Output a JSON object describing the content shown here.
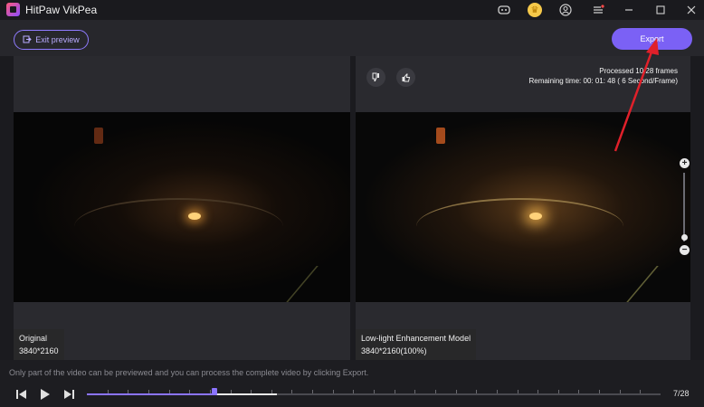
{
  "app": {
    "title": "HitPaw VikPea"
  },
  "titlebar_icons": [
    "discord-icon",
    "coin-icon",
    "user-icon",
    "menu-icon",
    "minimize-icon",
    "maximize-icon",
    "close-icon"
  ],
  "toolbar": {
    "exit_label": "Exit preview",
    "export_label": "Export"
  },
  "left_panel": {
    "name": "Original",
    "resolution": "3840*2160"
  },
  "right_panel": {
    "name": "Low-light Enhancement Model",
    "resolution": "3840*2160(100%)",
    "processed": "Processed 10/28 frames",
    "remaining": "Remaining time: 00: 01: 48 ( 6 Second/Frame)"
  },
  "footer": {
    "notice": "Only part of the video can be previewed and you can process the complete video by clicking Export.",
    "frame_counter": "7/28",
    "progress_fraction": 0.222
  },
  "colors": {
    "accent": "#7b61f5",
    "annotation_arrow": "#e0202a"
  }
}
